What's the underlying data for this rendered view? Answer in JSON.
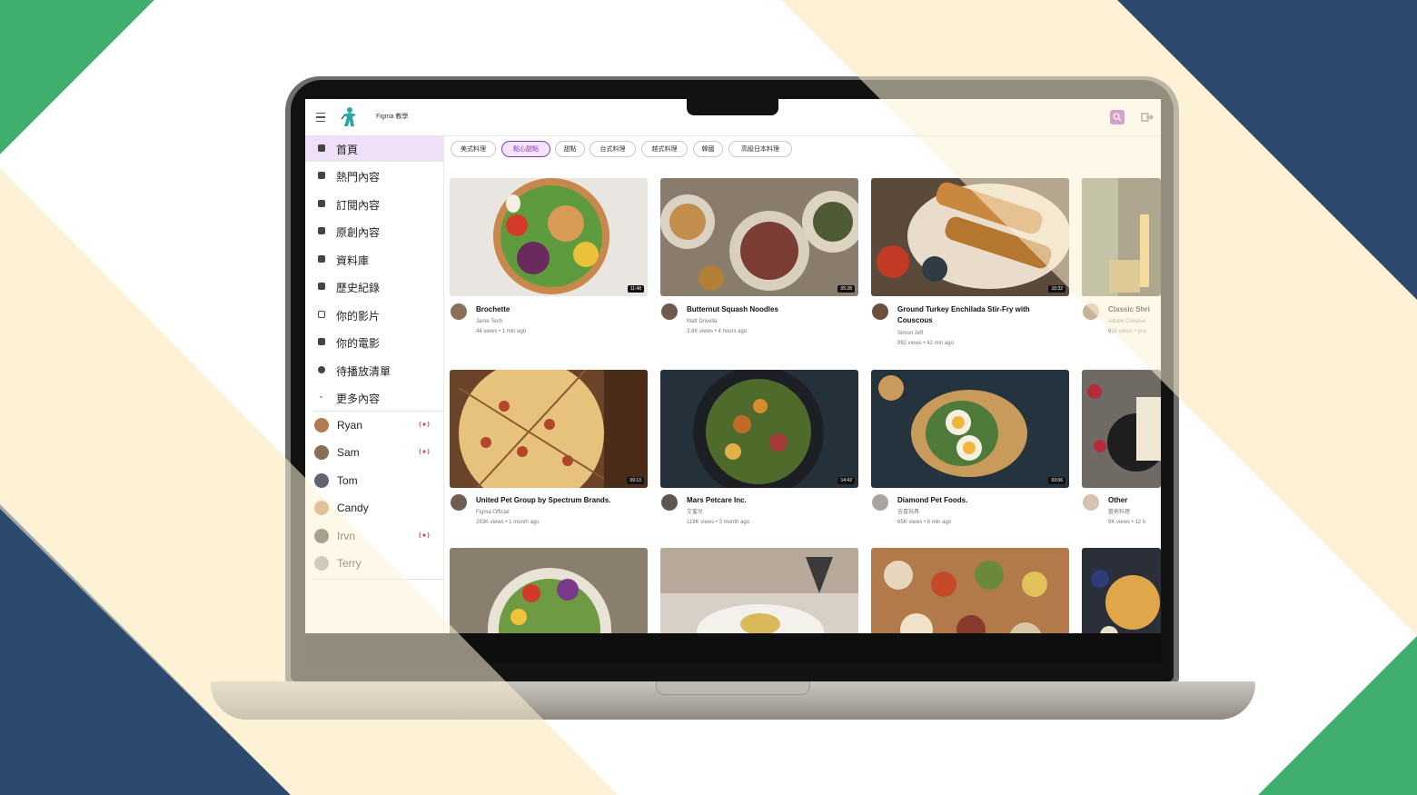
{
  "colors": {
    "green": "#3fae6e",
    "navy": "#2c4a6e",
    "cream": "#fdf2d6",
    "accent_purple": "#a43cc7"
  },
  "header": {
    "app_title": "Figma 教學",
    "logo_icon": "figure-logo-icon",
    "search_icon": "search-icon",
    "menu_icon": "menu-icon",
    "logout_icon": "logout-icon"
  },
  "sidebar": {
    "items": [
      {
        "label": "首頁",
        "icon": "home-icon",
        "active": true
      },
      {
        "label": "熱門內容",
        "icon": "fire-icon"
      },
      {
        "label": "訂閱內容",
        "icon": "subscriptions-icon"
      },
      {
        "label": "原創內容",
        "icon": "video-icon"
      },
      {
        "label": "資料庫",
        "icon": "library-icon"
      },
      {
        "label": "歷史紀錄",
        "icon": "history-icon"
      },
      {
        "label": "你的影片",
        "icon": "play-icon"
      },
      {
        "label": "你的電影",
        "icon": "movie-icon"
      },
      {
        "label": "待播放清單",
        "icon": "clock-icon"
      },
      {
        "label": "更多內容",
        "icon": "chevron-down-icon"
      }
    ],
    "subscriptions": [
      {
        "name": "Ryan",
        "live": true
      },
      {
        "name": "Sam",
        "live": true
      },
      {
        "name": "Tom",
        "live": false
      },
      {
        "name": "Candy",
        "live": false
      },
      {
        "name": "Irvn",
        "live": true
      },
      {
        "name": "Terry",
        "live": false
      }
    ]
  },
  "chips": [
    {
      "label": "美式料理"
    },
    {
      "label": "點心甜點",
      "active": true
    },
    {
      "label": "甜點"
    },
    {
      "label": "台式料理"
    },
    {
      "label": "越式料理"
    },
    {
      "label": "韓國"
    },
    {
      "label": "高級日本料理"
    }
  ],
  "videos": [
    {
      "title": "Brochette",
      "channel": "Jame Tech",
      "meta": "44 views • 1 min ago",
      "duration": "11:48"
    },
    {
      "title": "Butternut Squash Noodles",
      "channel": "Matt Drivella",
      "meta": "3.8K views • 4 hours ago",
      "duration": "05:28"
    },
    {
      "title": "Ground Turkey Enchilada Stir-Fry with Couscous",
      "channel": "Simon Jeff",
      "meta": "892 views • 42 min ago",
      "duration": "10:32"
    },
    {
      "title": "Classic Shri",
      "channel": "Adobe Creative",
      "meta": "916 views • yea",
      "duration": ""
    },
    {
      "title": "United Pet Group by Spectrum Brands.",
      "channel": "Figma Official",
      "meta": "283K views • 1 month ago",
      "duration": "09:13"
    },
    {
      "title": "Mars Petcare Inc.",
      "channel": "艾蜜兒",
      "meta": "119K views • 3 month ago",
      "duration": "14:42"
    },
    {
      "title": "Diamond Pet Foods.",
      "channel": "吉喜玩具",
      "meta": "65K views • 8 min ago",
      "duration": "03:06"
    },
    {
      "title": "Other",
      "channel": "藝術料理",
      "meta": "9K views • 12 h",
      "duration": ""
    }
  ]
}
